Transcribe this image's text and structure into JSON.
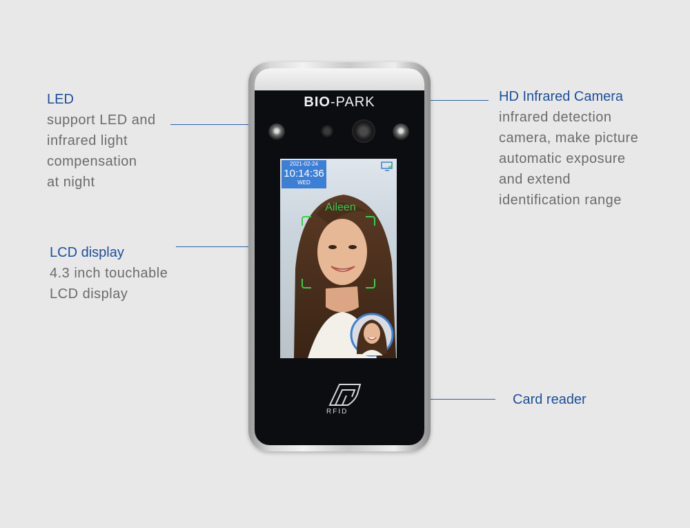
{
  "callouts": {
    "led": {
      "title": "LED",
      "lines": [
        "support LED and",
        "infrared light",
        "compensation",
        "at night"
      ]
    },
    "lcd": {
      "title": "LCD display",
      "lines": [
        "4.3 inch touchable",
        "LCD display"
      ]
    },
    "camera": {
      "title": "HD Infrared Camera",
      "lines": [
        "infrared detection",
        "camera, make picture",
        "automatic exposure",
        "and  extend",
        "identification range"
      ]
    },
    "card": {
      "title": "Card reader"
    }
  },
  "device": {
    "brand_bold": "BIO",
    "brand_rest": "-PARK",
    "screen": {
      "date": "2021-02-24",
      "time": "10:14:36",
      "day": "WED",
      "recognized_name": "Aileen"
    },
    "rfid_label": "RFID"
  },
  "colors": {
    "callout_title": "#1c4f9c",
    "callout_text": "#6b6b6b",
    "leader_line": "#2b5fae",
    "face_frame": "#34d24c",
    "clock_bg": "#3e7fd6"
  },
  "icons": [
    "led-lens-icon",
    "camera-lens-icon",
    "monitor-check-icon",
    "rfid-card-icon"
  ]
}
